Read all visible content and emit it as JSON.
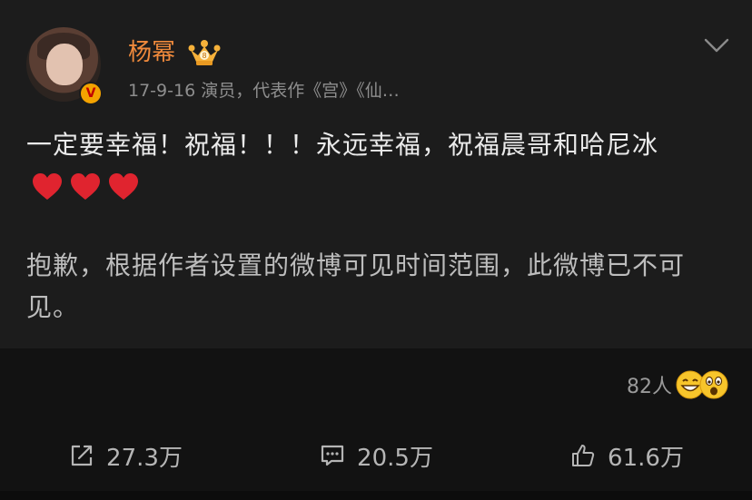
{
  "post": {
    "author": "杨幂",
    "meta": "17-9-16  演员，代表作《宫》《仙…",
    "text": "一定要幸福！祝福！！！永远幸福，祝福晨哥和哈尼冰",
    "notice": "抱歉，根据作者设置的微博可见时间范围，此微博已不可见。",
    "verified_badge": "V"
  },
  "icons": {
    "crown": "crown-icon",
    "more": "chevron-down-icon",
    "heart": "red-heart-icon",
    "reactions": [
      "laughing-face-icon",
      "surprised-face-icon"
    ]
  },
  "reactions": {
    "count": "82人"
  },
  "actions": {
    "repost": "27.3万",
    "comment": "20.5万",
    "like": "61.6万"
  },
  "colors": {
    "background": "#121212",
    "card": "#1c1c1c",
    "username": "#f08a3c",
    "heart": "#e0242f"
  }
}
